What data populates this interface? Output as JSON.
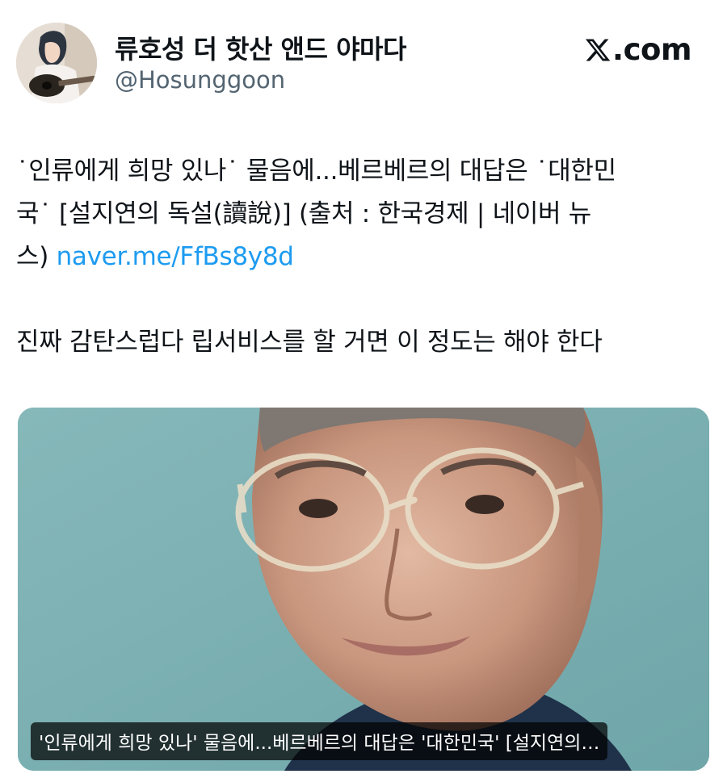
{
  "tweet": {
    "display_name": "류호성 더 핫산 앤드 야마다",
    "handle": "@Hosunggoon",
    "brand": ".com",
    "line1": "˙인류에게 희망 있나˙ 물음에...베르베르의 대답은 ˙대한민",
    "line2": "국˙  [설지연의 독설(讀說)] (출처 : 한국경제 | 네이버 뉴",
    "line3_prefix": "스) ",
    "link_text": "naver.me/FfBs8y8d",
    "comment": "진짜 감탄스럽다 립서비스를 할 거면 이 정도는 해야 한다"
  },
  "card": {
    "caption": "'인류에게 희망 있나' 물음에...베르베르의 대답은 '대한민국' [설지연의…"
  },
  "colors": {
    "link": "#1d9bf0",
    "card_background": "#7eb2b4",
    "handle": "#536471"
  },
  "icons": {
    "brand_logo": "x-logo-icon",
    "avatar": "user-avatar"
  }
}
